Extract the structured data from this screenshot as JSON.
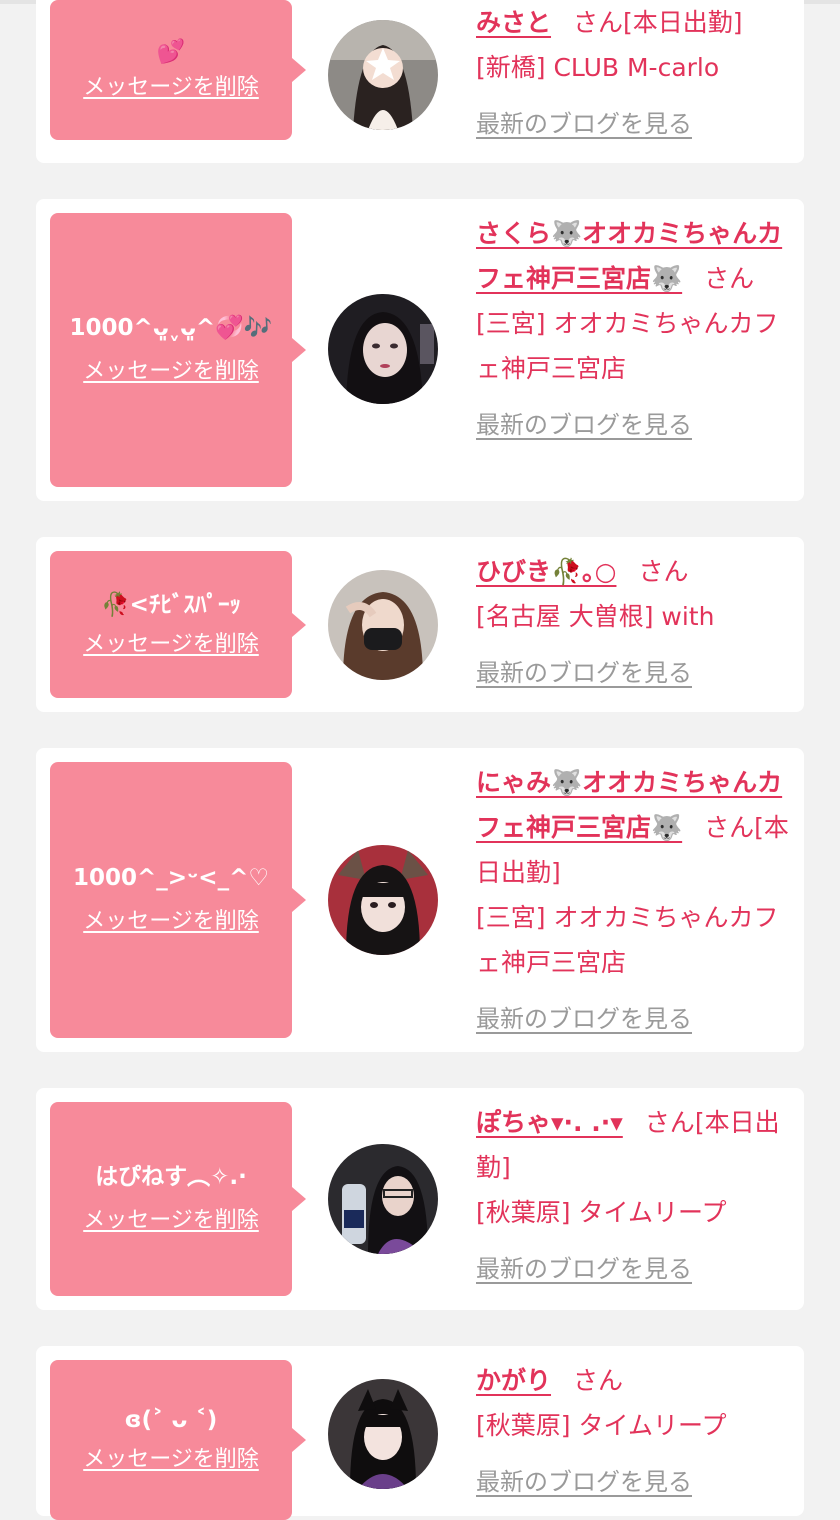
{
  "common": {
    "delete_label": "メッセージを削除",
    "blog_label": "最新のブログを見る",
    "honorific": "さん"
  },
  "entries": [
    {
      "message": "💕",
      "name": "みさと",
      "status": "[本日出勤]",
      "shop": "[新橋] CLUB M-carlo"
    },
    {
      "message": "1000^ᴗ͈ˬᴗ͈^💞🎶",
      "name": "さくら🐺オオカミちゃんカフェ神戸三宮店🐺",
      "status": "",
      "shop": "[三宮] オオカミちゃんカフェ神戸三宮店"
    },
    {
      "message": "🥀<ﾁﾋﾞｽﾊﾟｰｯ",
      "name": "ひびき🥀｡○",
      "status": "",
      "shop": "[名古屋 大曽根] with"
    },
    {
      "message": "1000^_>ᵕ<_^♡",
      "name": "にゃみ🐺オオカミちゃんカフェ神戸三宮店🐺",
      "status": "[本日出勤]",
      "shop": "[三宮] オオカミちゃんカフェ神戸三宮店"
    },
    {
      "message": "はぴねす︵✧.·",
      "name": "ぽちゃ▾·. .·▾",
      "status": "[本日出勤]",
      "shop": "[秋葉原] タイムリープ"
    },
    {
      "message": "ɞ(˃ ᴗ ˂)",
      "name": "かがり",
      "status": "",
      "shop": "[秋葉原] タイムリープ"
    }
  ],
  "colors": {
    "bubble": "#f78a9a",
    "name_text": "#e2335a",
    "link_gray": "#9a9a9a",
    "background": "#f2f2f2"
  }
}
